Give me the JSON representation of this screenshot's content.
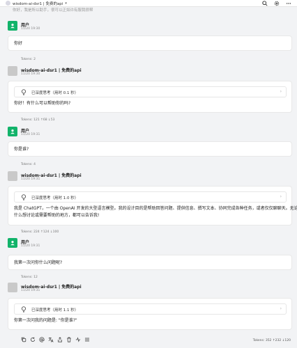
{
  "topbar": {
    "model_label": "wisdom-ai-dsr1 | 免费的api"
  },
  "partial_text": "你好，我是所以助手，很可以正如许有服我很帮",
  "messages": [
    {
      "role": "user",
      "name": "用户",
      "time": "11/20 19:30",
      "text": "你好",
      "tokens": "Tokens: 2"
    },
    {
      "role": "bot",
      "name": "wisdom-ai-dsr1 | 免费的api",
      "time": "11/20 19:30",
      "thinking": "已深度思考（用时 0.1 秒）",
      "text": "你好！有什么可以帮助你的吗?",
      "tokens": "Tokens: 121 ↑68 ↓53"
    },
    {
      "role": "user",
      "name": "用户",
      "time": "11/20 19:31",
      "text": "你是谁?",
      "tokens": "Tokens: 4"
    },
    {
      "role": "bot",
      "name": "wisdom-ai-dsr1 | 免费的api",
      "time": "11/20 19:31",
      "thinking": "已深度思考（用时 1.0 秒）",
      "text_lines": [
        "我是 ChatGPT，一个由 OpenAI 开发的大型语言模型。我的设计目的是帮助回答问题、提供信息、撰写文本、协同完成各种任务，或者仅仅聊聊天。无论你有",
        "什么想讨论或需要帮助的地方，都可以告诉我!"
      ],
      "tokens": "Tokens: 224 ↑124 ↓100"
    },
    {
      "role": "user",
      "name": "用户",
      "time": "11/20 19:31",
      "text": "我第一次问你什么问题呢?",
      "tokens": "Tokens: 12"
    },
    {
      "role": "bot",
      "name": "wisdom-ai-dsr1 | 免费的api",
      "time": "11/20 19:31",
      "thinking": "已深度思考（用时 1.1 秒）",
      "text": "你第一次问我的问题是: \"你是谁?\""
    }
  ],
  "footer": {
    "tokens": "Tokens: 352 ↑232 ↓120"
  },
  "colors": {
    "user_avatar": "#12b36a",
    "bot_avatar": "#c9c9c9",
    "background": "#f2f3f5"
  }
}
